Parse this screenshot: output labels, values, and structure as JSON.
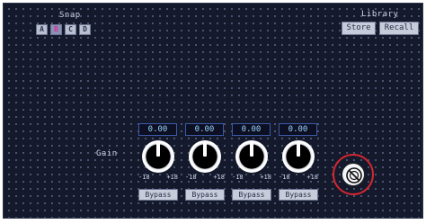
{
  "snap": {
    "title": "Snap",
    "buttons": [
      {
        "label": "A",
        "active": false
      },
      {
        "label": "B",
        "active": true
      },
      {
        "label": "C",
        "active": false
      },
      {
        "label": "D",
        "active": false
      }
    ]
  },
  "library": {
    "title": "Library",
    "store_label": "Store",
    "recall_label": "Recall"
  },
  "gain": {
    "label": "Gain",
    "channels": [
      {
        "value": "0.00",
        "min": "-18",
        "max": "+18",
        "bypass_label": "Bypass"
      },
      {
        "value": "0.00",
        "min": "-18",
        "max": "+18",
        "bypass_label": "Bypass"
      },
      {
        "value": "0.00",
        "min": "-18",
        "max": "+18",
        "bypass_label": "Bypass"
      },
      {
        "value": "0.00",
        "min": "-18",
        "max": "+18",
        "bypass_label": "Bypass"
      }
    ]
  },
  "colors": {
    "panel_bg": "#141a2c",
    "highlight_circle": "#d32630",
    "active_snap_text": "#d2328c"
  },
  "icons": {
    "reset": "circle-slash-icon"
  }
}
